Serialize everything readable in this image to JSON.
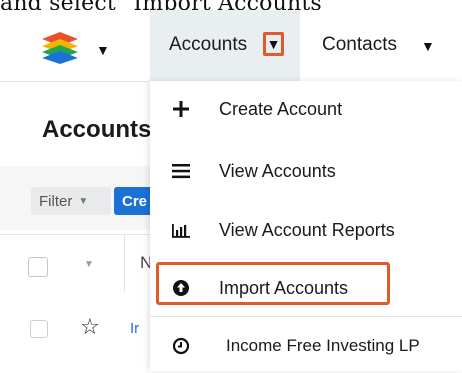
{
  "caption": "and select \"Import Accounts\"",
  "header": {
    "accounts_label": "Accounts",
    "contacts_label": "Contacts"
  },
  "page": {
    "title": "Accounts",
    "filter_label": "Filter",
    "create_label": "Cre"
  },
  "table": {
    "header_name_peek": "N",
    "row1_name_peek": "Ir"
  },
  "dropdown": {
    "create_label": "Create Account",
    "view_label": "View Accounts",
    "reports_label": "View Account Reports",
    "import_label": "Import Accounts",
    "recent_label": "Income Free Investing LP"
  },
  "colors": {
    "highlight": "#e25a2b",
    "active_tab_bg": "#e9eef1",
    "primary_blue": "#1b71d6"
  },
  "icons": {
    "logo": "sugar-cube-logo",
    "plus": "plus-icon",
    "list": "list-icon",
    "reports": "bar-chart-icon",
    "import": "upload-circle-icon",
    "recent": "clock-icon",
    "star": "star-icon"
  }
}
